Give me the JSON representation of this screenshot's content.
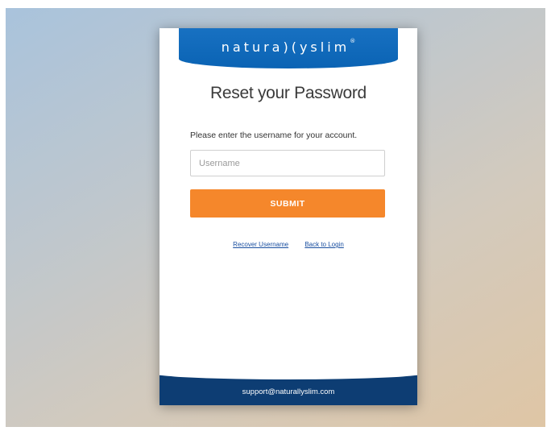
{
  "brand": {
    "logo_text": "natura)(yslim",
    "logo_mark": "®",
    "header_color": "#0a63b4"
  },
  "form": {
    "title": "Reset your Password",
    "instructions": "Please enter the username for your account.",
    "username_placeholder": "Username",
    "username_value": "",
    "submit_label": "SUBMIT",
    "submit_color": "#f5872b"
  },
  "links": {
    "recover_username": "Recover Username",
    "back_to_login": "Back to Login"
  },
  "footer": {
    "email": "support@naturallyslim.com",
    "color": "#0d3d73"
  }
}
